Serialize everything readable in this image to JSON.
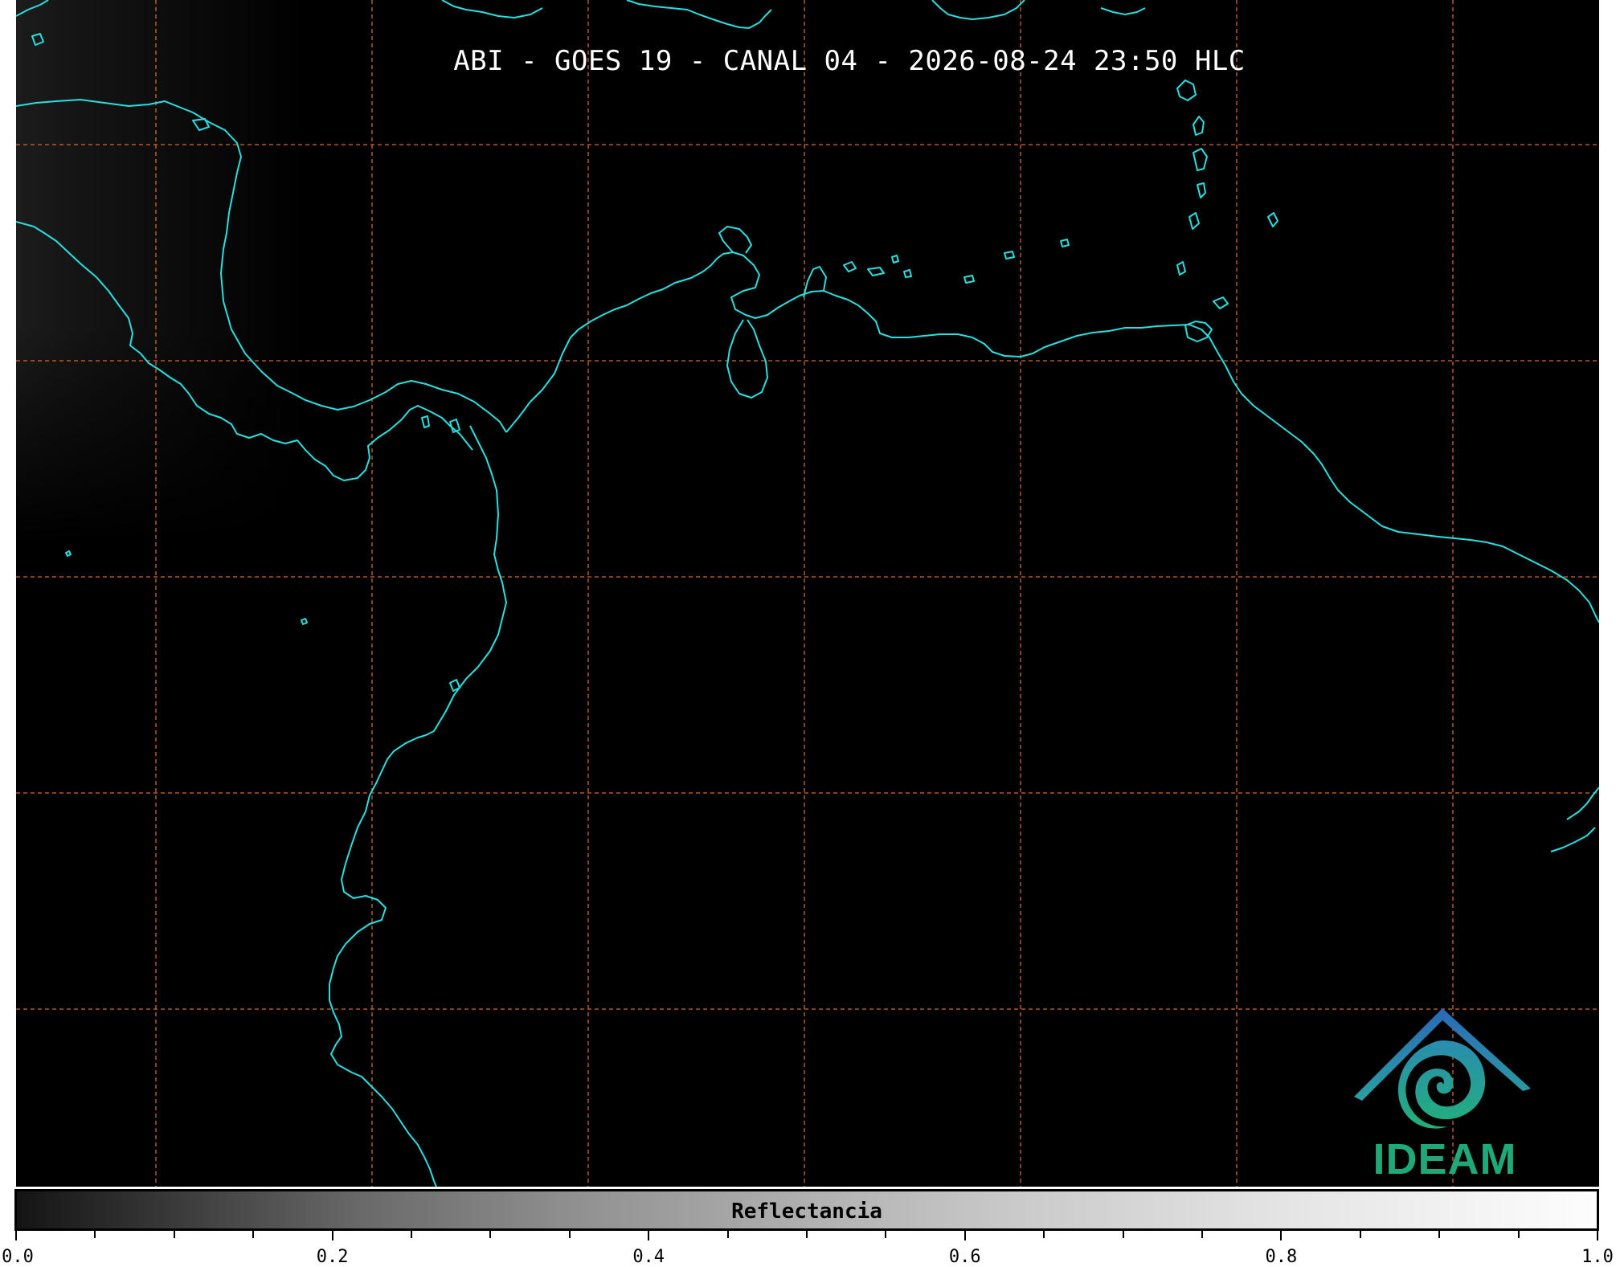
{
  "title": "ABI - GOES 19 - CANAL 04 - 2026-08-24 23:50 HLC",
  "colorbar": {
    "label": "Reflectancia",
    "ticks": [
      "0.0",
      "0.2",
      "0.4",
      "0.6",
      "0.8",
      "1.0"
    ],
    "range": [
      0.0,
      1.0
    ]
  },
  "logo": {
    "text": "IDEAM",
    "icon": "ideam-logo-icon"
  },
  "colors": {
    "background": "#000000",
    "coastline": "#27e0e0",
    "gridline": "#d06a2a",
    "logo_text": "#1fa878",
    "logo_roof": "#2a73b8"
  }
}
